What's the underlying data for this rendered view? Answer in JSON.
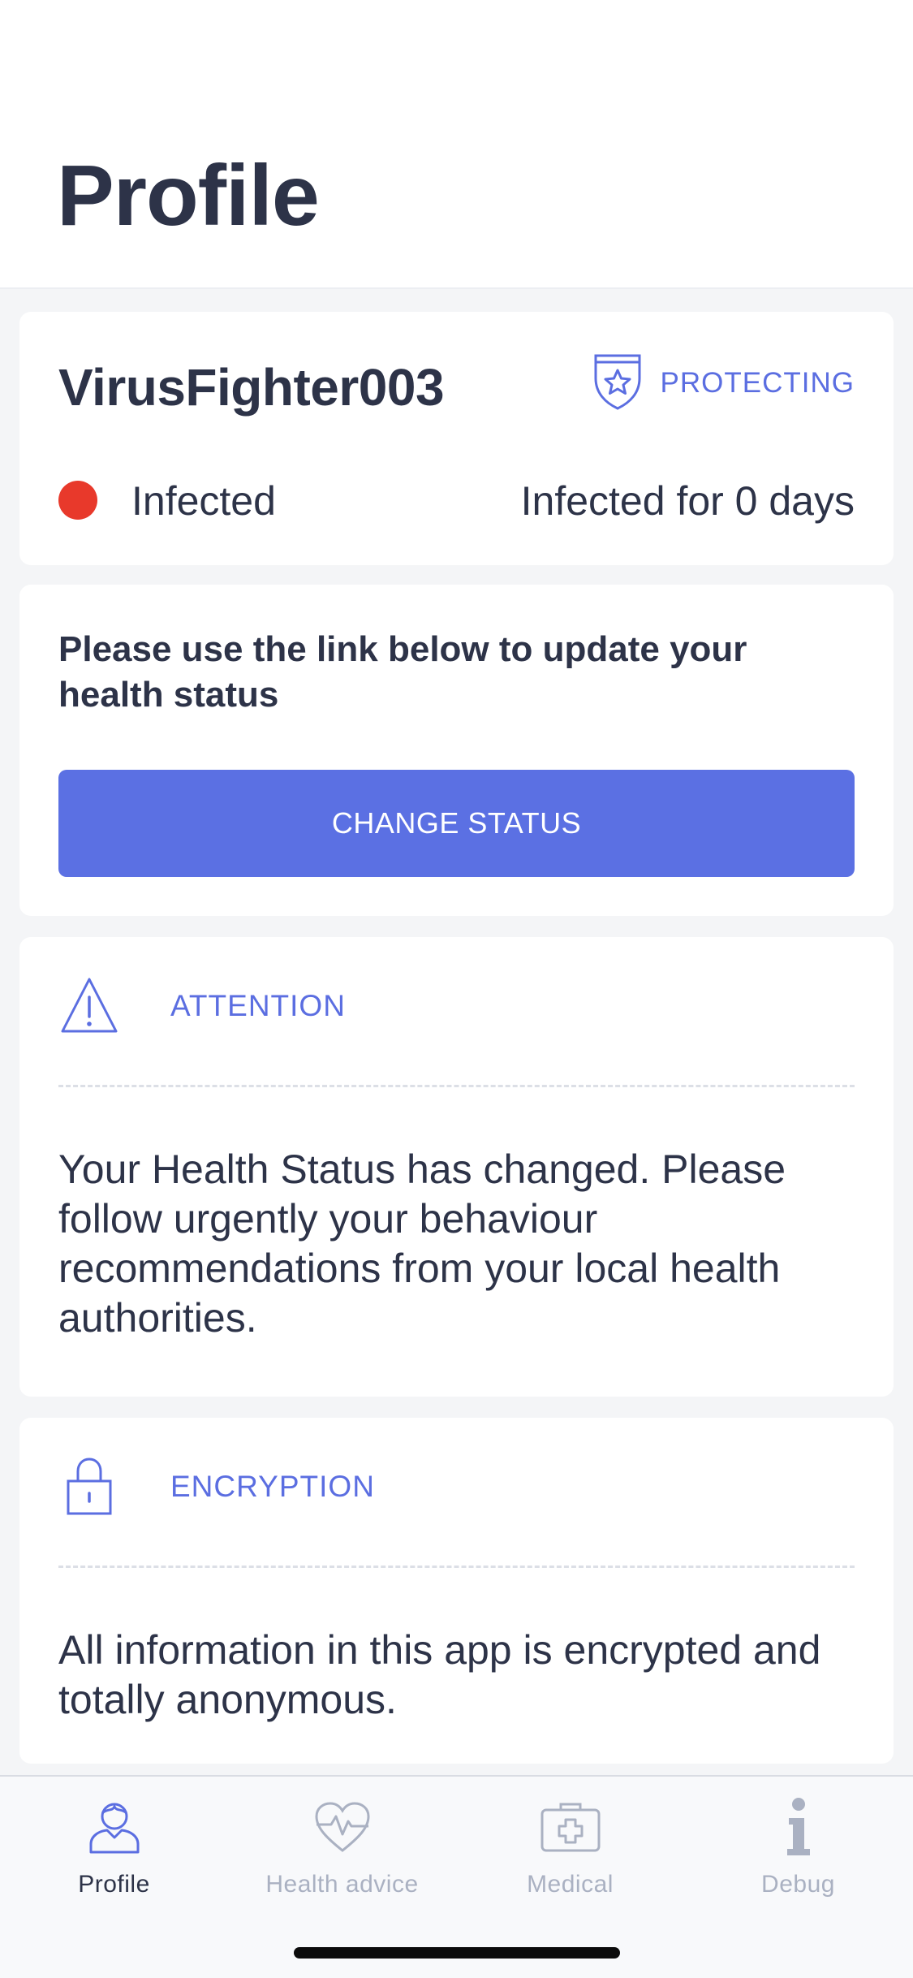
{
  "header": {
    "title": "Profile"
  },
  "user_card": {
    "username": "VirusFighter003",
    "protect_icon": "shield-star-icon",
    "protect_label": "PROTECTING",
    "status_label": "Infected",
    "status_color": "#e8392b",
    "status_duration": "Infected for 0 days"
  },
  "change_card": {
    "text": "Please use the link below to update your health status",
    "button_label": "CHANGE STATUS",
    "button_color": "#5b70e3"
  },
  "attention_card": {
    "icon": "warning-triangle-icon",
    "title": "ATTENTION",
    "body": "Your Health Status has changed. Please follow urgently your behaviour recommendations from your local health authorities."
  },
  "encryption_card": {
    "icon": "padlock-icon",
    "title": "ENCRYPTION",
    "body": "All information in this app is encrypted and totally anonymous."
  },
  "tab_bar": {
    "tabs": [
      {
        "label": "Profile",
        "icon": "person-icon",
        "active": true
      },
      {
        "label": "Health advice",
        "icon": "heart-pulse-icon",
        "active": false
      },
      {
        "label": "Medical",
        "icon": "medical-kit-icon",
        "active": false
      },
      {
        "label": "Debug",
        "icon": "info-icon",
        "active": false
      }
    ]
  },
  "colors": {
    "accent": "#5b6ee1",
    "text": "#2d3348",
    "inactive": "#aab1c2",
    "background": "#f4f5f7"
  }
}
